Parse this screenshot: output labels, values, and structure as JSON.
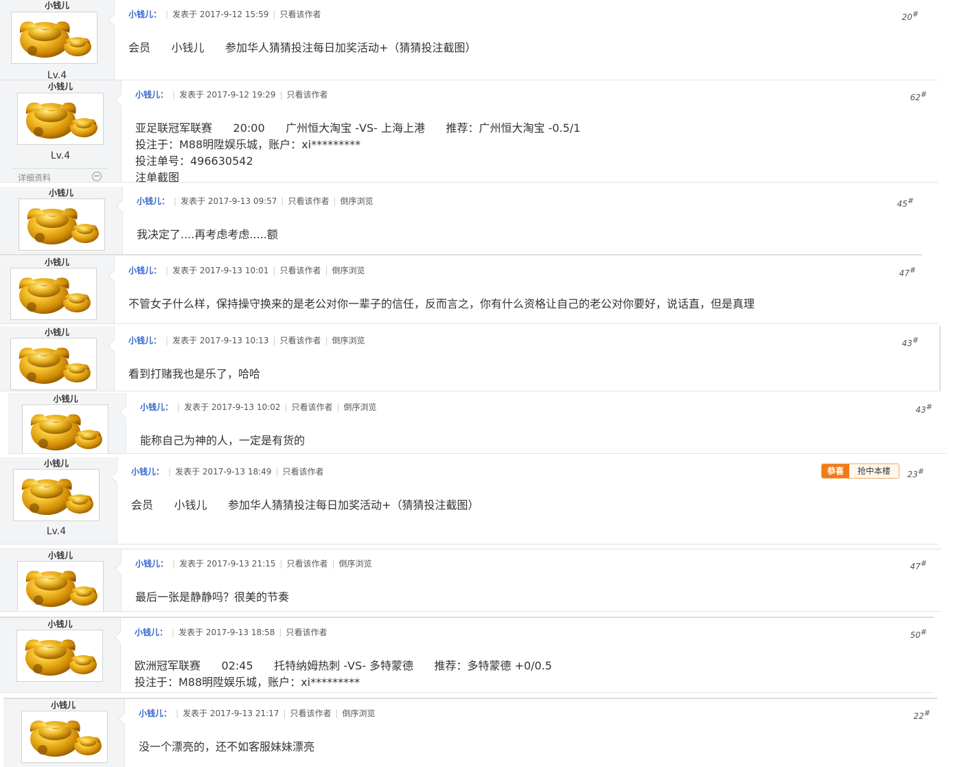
{
  "common": {
    "posted_prefix": "发表于",
    "only_author": "只看该作者",
    "reverse": "倒序浏览",
    "detail_label": "详细资料",
    "colors": {
      "author": "#3366cc",
      "badge": "#f27a1a",
      "sidebar_bg": "#f3f4f6"
    }
  },
  "posts": [
    {
      "username": "小钱儿",
      "author": "小钱儿：",
      "date": "2017-9-12 15:59",
      "floor": "20",
      "level": "Lv.4",
      "content": "会员      小钱儿      参加华人猜猜投注每日加奖活动+（猜猜投注截图）"
    },
    {
      "username": "小钱儿",
      "author": "小钱儿：",
      "date": "2017-9-12 19:29",
      "floor": "62",
      "level": "Lv.4",
      "content": "亚足联冠军联赛      20:00      广州恒大淘宝 -VS- 上海上港      推荐：广州恒大淘宝 -0.5/1\n投注于：M88明陞娱乐城，账户：xi*********\n投注单号：496630542\n注单截图"
    },
    {
      "username": "小钱儿",
      "author": "小钱儿：",
      "date": "2017-9-13 09:57",
      "floor": "45",
      "content": "我决定了....再考虑考虑.....额"
    },
    {
      "username": "小钱儿",
      "author": "小钱儿：",
      "date": "2017-9-13 10:01",
      "floor": "47",
      "content": "不管女子什么样，保持操守换来的是老公对你一辈子的信任，反而言之，你有什么资格让自己的老公对你要好，说话直，但是真理"
    },
    {
      "username": "小钱儿",
      "author": "小钱儿：",
      "date": "2017-9-13 10:13",
      "floor": "43",
      "content": "看到打赌我也是乐了，哈哈"
    },
    {
      "username": "小钱儿",
      "author": "小钱儿：",
      "date": "2017-9-13 10:02",
      "floor": "43",
      "content": "能称自己为神的人，一定是有货的"
    },
    {
      "username": "小钱儿",
      "author": "小钱儿：",
      "date": "2017-9-13 18:49",
      "floor": "23",
      "level": "Lv.4",
      "badge_a": "恭喜",
      "badge_b": "抢中本楼",
      "content": "会员      小钱儿      参加华人猜猜投注每日加奖活动+（猜猜投注截图）"
    },
    {
      "username": "小钱儿",
      "author": "小钱儿：",
      "date": "2017-9-13 21:15",
      "floor": "47",
      "content": "最后一张是静静吗？很美的节奏"
    },
    {
      "username": "小钱儿",
      "author": "小钱儿：",
      "date": "2017-9-13 18:58",
      "floor": "50",
      "content": "欧洲冠军联赛      02:45      托特纳姆热刺 -VS- 多特蒙德      推荐：多特蒙德 +0/0.5\n投注于：M88明陞娱乐城，账户：xi*********"
    },
    {
      "username": "小钱儿",
      "author": "小钱儿：",
      "date": "2017-9-13 21:17",
      "floor": "22",
      "content": "没一个漂亮的，还不如客服妹妹漂亮"
    }
  ]
}
